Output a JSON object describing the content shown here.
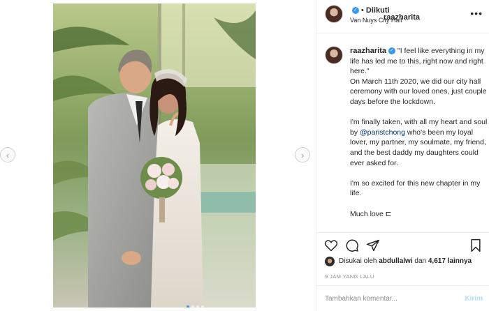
{
  "post": {
    "photo_alt": "",
    "carousel_dots": 4,
    "carousel_active": 0
  },
  "nav": {
    "prev_icon": "chevron-left-icon",
    "next_icon": "chevron-right-icon",
    "prev_glyph": "‹",
    "next_glyph": "›"
  },
  "header": {
    "username": "raazharita",
    "separator": "•",
    "follow_status": "Diikuti",
    "location": "Van Nuys City Hall",
    "more_glyph": "•••"
  },
  "caption": {
    "username": "raazharita",
    "line_quote": "\"I feel like everything in my life has led me to this, right now and right here.\"",
    "line_story": "On March 11th 2020, we did our city hall ceremony with our loved ones, just couple days before the lockdown.",
    "line_taken_before": "I'm finally taken, with all my heart and soul by ",
    "mention": "@paristchong",
    "line_taken_after": " who's been my loyal lover, my partner, my soulmate, my friend, and the best daddy my daughters could ever asked for.",
    "line_excited": "I'm so excited for this new chapter in my life.",
    "line_love": "Much love ⊏"
  },
  "likes": {
    "prefix": "Disukai oleh ",
    "liker": "abdullalwi",
    "middle": " dan ",
    "count": "4,617 lainnya"
  },
  "timestamp": "9 JAM YANG LALU",
  "comment": {
    "placeholder": "Tambahkan komentar...",
    "post_label": "Kirim"
  },
  "colors": {
    "accent": "#3897f0",
    "mention": "#003569",
    "muted": "#8e8e8e",
    "post_disabled": "#b2dffc"
  }
}
